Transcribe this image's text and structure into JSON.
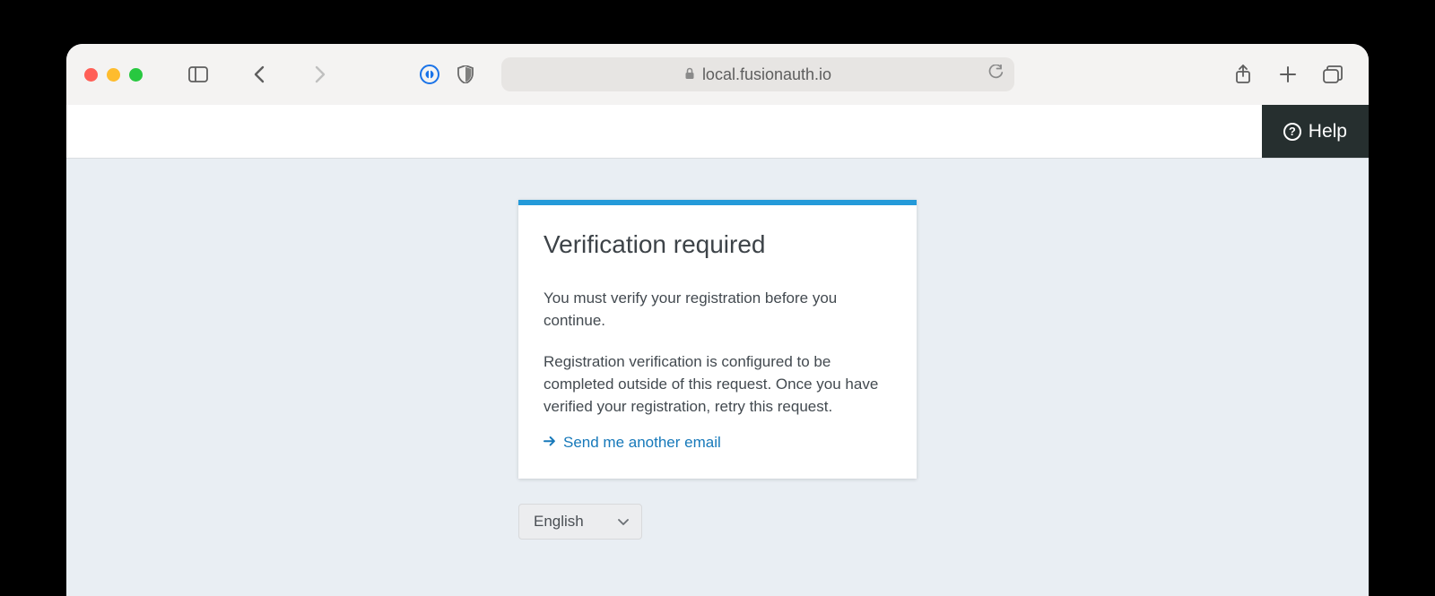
{
  "browser": {
    "url": "local.fusionauth.io"
  },
  "topbar": {
    "help_label": "Help"
  },
  "card": {
    "title": "Verification required",
    "p1": "You must verify your registration before you continue.",
    "p2": "Registration verification is configured to be completed outside of this request. Once you have verified your registration, retry this request.",
    "resend_link": "Send me another email"
  },
  "language": {
    "selected": "English"
  }
}
